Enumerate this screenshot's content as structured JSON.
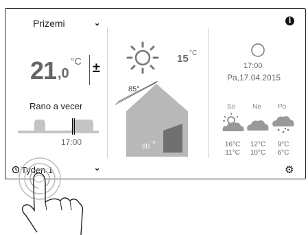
{
  "header": {
    "zone": "Prizemi"
  },
  "room": {
    "temp_int": "21",
    "temp_dec": ",0",
    "unit": "°C",
    "adjust": "±"
  },
  "schedule": {
    "name": "Rano a vecer",
    "time": "17:00"
  },
  "outside": {
    "temp": "15",
    "unit": "°C",
    "roof_angle": "85°",
    "water_temp": "80",
    "water_unit": "°C"
  },
  "clock": {
    "time": "17:00",
    "date": "Pa,17.04.2015"
  },
  "forecast": [
    {
      "day": "So",
      "icon": "partly-sunny-icon",
      "high": "16°C",
      "low": "11°C"
    },
    {
      "day": "Ne",
      "icon": "cloud-icon",
      "high": "12°C",
      "low": "10°C"
    },
    {
      "day": "Po",
      "icon": "rain-cloud-icon",
      "high": "9°C",
      "low": "6°C"
    }
  ],
  "footer": {
    "program": "Tyden 1"
  },
  "colors": {
    "house_fill": "#b8b8b8",
    "tank_fill": "#707070",
    "slider_fill": "#c4c4c4"
  }
}
